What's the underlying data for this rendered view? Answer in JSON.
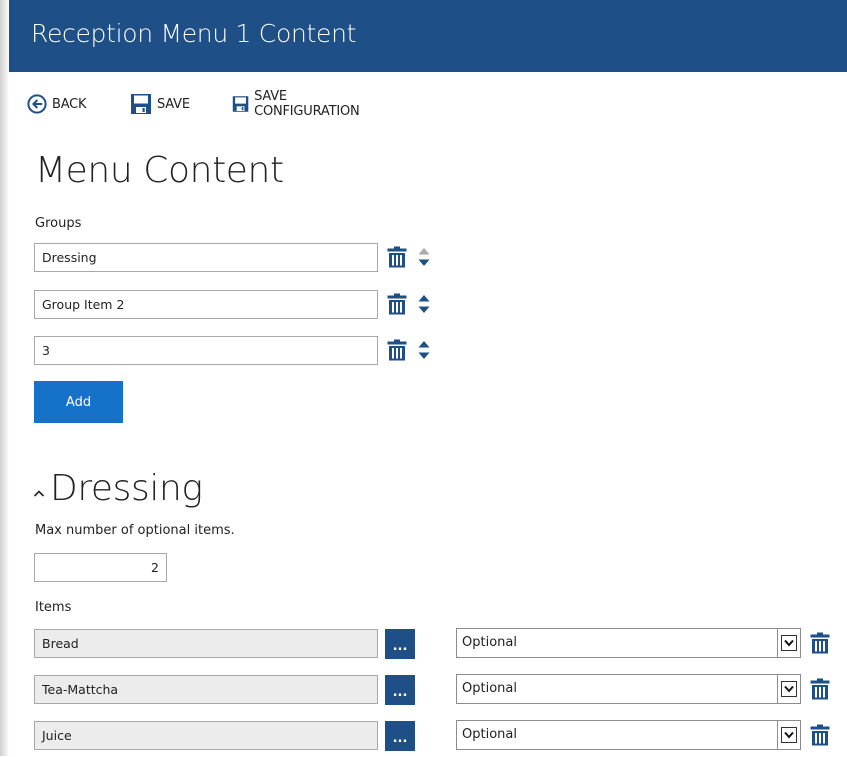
{
  "window": {
    "title": "Reception Menu 1 Content"
  },
  "toolbar": {
    "back_label": "BACK",
    "save_label": "SAVE",
    "save_config_label": "SAVE CONFIGURATION"
  },
  "page": {
    "heading": "Menu Content"
  },
  "groups": {
    "label": "Groups",
    "items": [
      {
        "value": "Dressing"
      },
      {
        "value": "Group Item 2"
      },
      {
        "value": "3"
      }
    ],
    "add_label": "Add"
  },
  "section": {
    "title": "Dressing",
    "max_label": "Max number of optional items.",
    "max_value": "2",
    "items_label": "Items",
    "items": [
      {
        "name": "Bread",
        "more_label": "...",
        "option": "Optional"
      },
      {
        "name": "Tea-Mattcha",
        "more_label": "...",
        "option": "Optional"
      },
      {
        "name": "Juice",
        "more_label": "...",
        "option": "Optional"
      }
    ]
  },
  "colors": {
    "titlebar": "#1e4f87",
    "accent_button": "#1572c8",
    "icon_blue": "#1e4f87"
  }
}
